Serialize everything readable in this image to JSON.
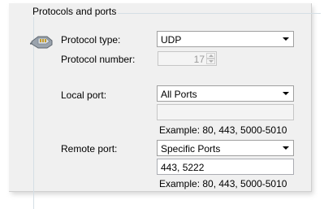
{
  "group": {
    "title": "Protocols and ports"
  },
  "protocol_type": {
    "label": "Protocol type:",
    "value": "UDP"
  },
  "protocol_number": {
    "label": "Protocol number:",
    "value": "17"
  },
  "local_port": {
    "label": "Local port:",
    "value": "All Ports",
    "input_value": "",
    "example": "Example: 80, 443, 5000-5010"
  },
  "remote_port": {
    "label": "Remote port:",
    "value": "Specific Ports",
    "input_value": "443, 5222",
    "example": "Example: 80, 443, 5000-5010"
  },
  "icon": "network-cable-icon"
}
